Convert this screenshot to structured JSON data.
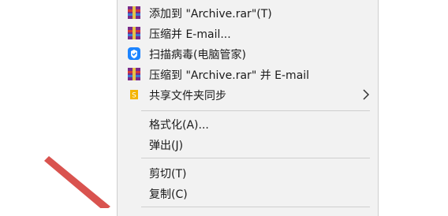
{
  "menu": {
    "items": [
      {
        "label": "添加到 \"Archive.rar\"(T)",
        "icon": "winrar-icon"
      },
      {
        "label": "压缩并 E-mail...",
        "icon": "winrar-icon"
      },
      {
        "label": "扫描病毒(电脑管家)",
        "icon": "tencent-pc-manager-shield-icon"
      },
      {
        "label": "压缩到 \"Archive.rar\" 并 E-mail",
        "icon": "winrar-icon"
      },
      {
        "label": "共享文件夹同步",
        "icon": "share-sync-icon",
        "submenu": true
      },
      {
        "label": "格式化(A)..."
      },
      {
        "label": "弹出(J)"
      },
      {
        "label": "剪切(T)"
      },
      {
        "label": "复制(C)"
      }
    ]
  },
  "colors": {
    "menu_background": "#f2f2f2",
    "separator": "#cfcfcf",
    "annotation_arrow": "#d9534f"
  }
}
